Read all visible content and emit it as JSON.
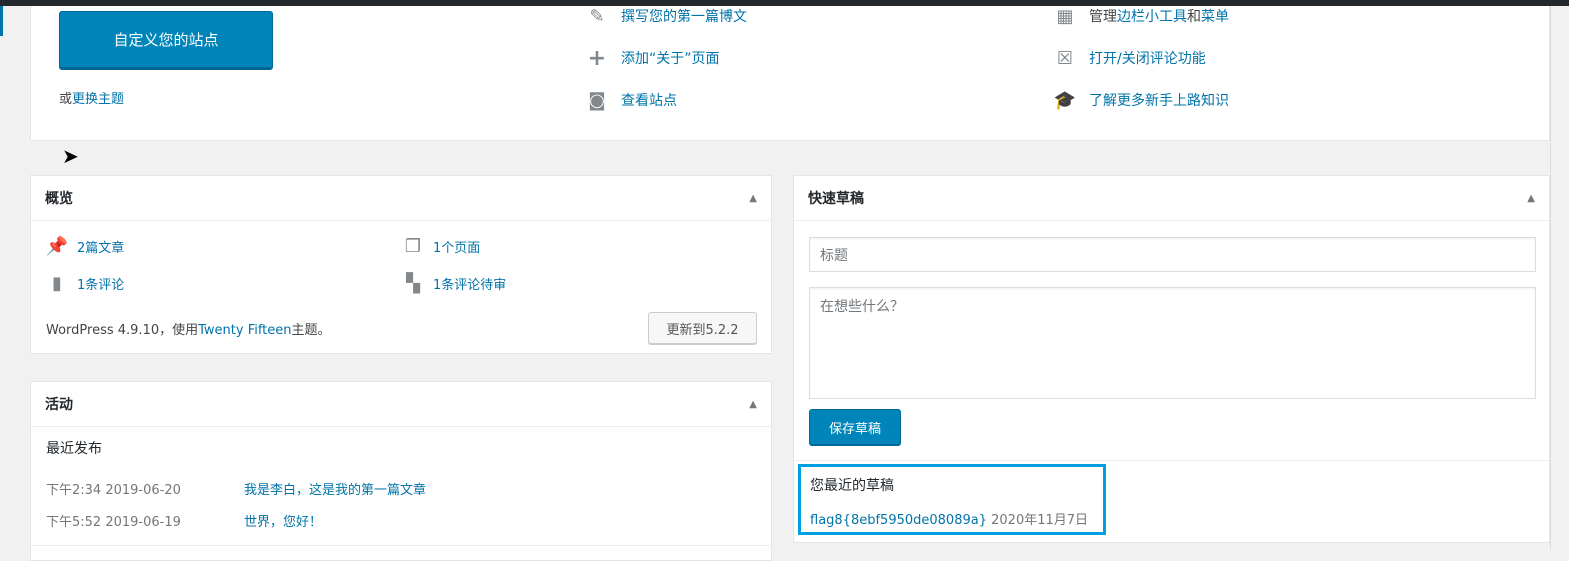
{
  "welcome": {
    "customize_button": "自定义您的站点",
    "or": "或",
    "change_theme": "更换主题",
    "actions": [
      {
        "label": "撰写您的第一篇博文"
      },
      {
        "label": "添加“关于”页面"
      },
      {
        "label": "查看站点"
      }
    ],
    "more": {
      "manage_prefix": "管理",
      "widgets": "边栏小工具",
      "and": "和",
      "menus": "菜单",
      "comments": "打开/关闭评论功能",
      "learn": "了解更多新手上路知识"
    }
  },
  "glance": {
    "title": "概览",
    "posts": "2篇文章",
    "pages": "1个页面",
    "comments": "1条评论",
    "pending": "1条评论待审",
    "version_prefix": "WordPress 4.9.10，使用",
    "theme": "Twenty Fifteen",
    "version_suffix": "主题。",
    "update_button": "更新到5.2.2"
  },
  "activity": {
    "title": "活动",
    "recent": "最近发布",
    "items": [
      {
        "time": "下午2:34 2019-06-20",
        "title": "我是李白，这是我的第一篇文章"
      },
      {
        "time": "下午5:52 2019-06-19",
        "title": "世界，您好！"
      }
    ]
  },
  "draft": {
    "title": "快速草稿",
    "title_placeholder": "标题",
    "content_placeholder": "在想些什么？",
    "save_button": "保存草稿",
    "recent_heading": "您最近的草稿",
    "recent": [
      {
        "title": "flag8{8ebf5950de08089a}",
        "date": "2020年11月7日"
      }
    ]
  },
  "colors": {
    "primary": "#0085ba",
    "link": "#0073aa",
    "highlight": "#00a0e0"
  }
}
